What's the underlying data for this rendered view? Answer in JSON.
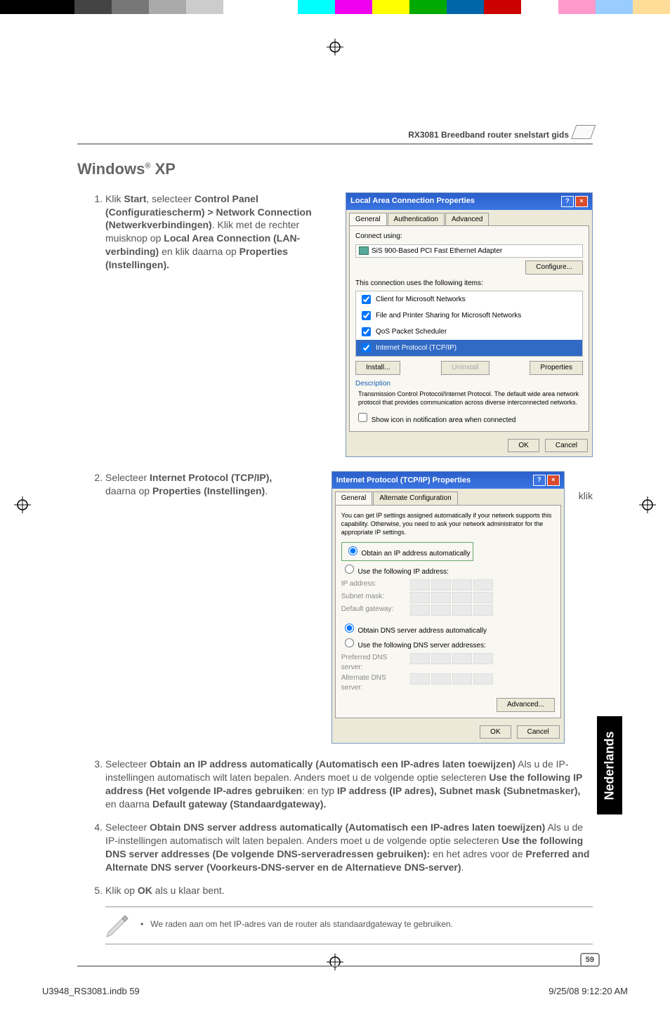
{
  "header": {
    "title": "RX3081 Breedband router snelstart gids"
  },
  "section_title_pre": "Windows",
  "section_title_sup": "®",
  "section_title_post": " XP",
  "step1": {
    "num": "1.",
    "pre": "Klik ",
    "b1": "Start",
    "t1": ", selecteer ",
    "b2": "Control Panel (Configuratiescherm) > Network Connection (Netwerkverbindingen)",
    "t2": ". Klik met de rechter muisknop op ",
    "b3": "Local Area Connection (LAN-verbinding)",
    "t3": " en klik daarna op  ",
    "b4": "Properties (Instellingen)."
  },
  "dialog1": {
    "title": "Local Area Connection Properties",
    "tabs": {
      "general": "General",
      "auth": "Authentication",
      "adv": "Advanced"
    },
    "connect_using": "Connect using:",
    "adapter": "SiS 900-Based PCI Fast Ethernet Adapter",
    "configure": "Configure...",
    "uses": "This connection uses the following items:",
    "items": [
      "Client for Microsoft Networks",
      "File and Printer Sharing for Microsoft Networks",
      "QoS Packet Scheduler",
      "Internet Protocol (TCP/IP)"
    ],
    "install": "Install...",
    "uninstall": "Uninstall",
    "properties": "Properties",
    "description_label": "Description",
    "description": "Transmission Control Protocol/Internet Protocol. The default wide area network protocol that provides communication across diverse interconnected networks.",
    "show_icon": "Show icon in notification area when connected",
    "ok": "OK",
    "cancel": "Cancel"
  },
  "step2": {
    "num": "2.",
    "pre": "Selecteer ",
    "b1": "Internet Protocol (TCP/IP),",
    "trail": " klik",
    "t1": "daarna op ",
    "b2": "Properties (Instellingen)",
    "t2": "."
  },
  "dialog2": {
    "title": "Internet Protocol (TCP/IP) Properties",
    "tabs": {
      "general": "General",
      "alt": "Alternate Configuration"
    },
    "intro": "You can get IP settings assigned automatically if your network supports this capability. Otherwise, you need to ask your network administrator for the appropriate IP settings.",
    "r1": "Obtain an IP address automatically",
    "r2": "Use the following IP address:",
    "ip": "IP address:",
    "subnet": "Subnet mask:",
    "gateway": "Default gateway:",
    "r3": "Obtain DNS server address automatically",
    "r4": "Use the following DNS server addresses:",
    "pdns": "Preferred DNS server:",
    "adns": "Alternate DNS server:",
    "advanced": "Advanced...",
    "ok": "OK",
    "cancel": "Cancel"
  },
  "step3": {
    "num": "3.",
    "pre": "Selecteer ",
    "b1": "Obtain an IP address automatically (Automatisch een IP-adres laten toewijzen)",
    "t1": "  Als u de IP-instellingen automatisch wilt laten bepalen. Anders moet u de volgende optie selecteren ",
    "b2": "Use the following IP address (Het volgende IP-adres gebruiken",
    "t2": ": en typ ",
    "b3": "IP address (IP adres), Subnet mask (Subnetmasker),",
    "t3": " en daarna ",
    "b4": "Default gateway (Standaardgateway)."
  },
  "step4": {
    "num": "4.",
    "pre": "Selecteer ",
    "b1": "Obtain DNS server address automatically (Automatisch een IP-adres laten toewijzen)",
    "t1": " Als u de IP-instellingen automatisch wilt laten bepalen. Anders moet u de volgende optie selecteren ",
    "b2": "Use the following DNS server addresses (De volgende DNS-serveradressen gebruiken):",
    "t2": " en het adres voor de ",
    "b3": "Preferred and Alternate DNS server (Voorkeurs-DNS-server en de Alternatieve DNS-server)",
    "t3": "."
  },
  "step5": {
    "num": "5.",
    "pre": "Klik op ",
    "b1": "OK",
    "t1": " als u klaar bent."
  },
  "note": {
    "text": "We raden aan om het IP-adres van de router als standaardgateway te gebruiken."
  },
  "lang_tab": "Nederlands",
  "page_number": "59",
  "footer": {
    "left": "U3948_RS3081.indb   59",
    "right": "9/25/08   9:12:20 AM"
  }
}
